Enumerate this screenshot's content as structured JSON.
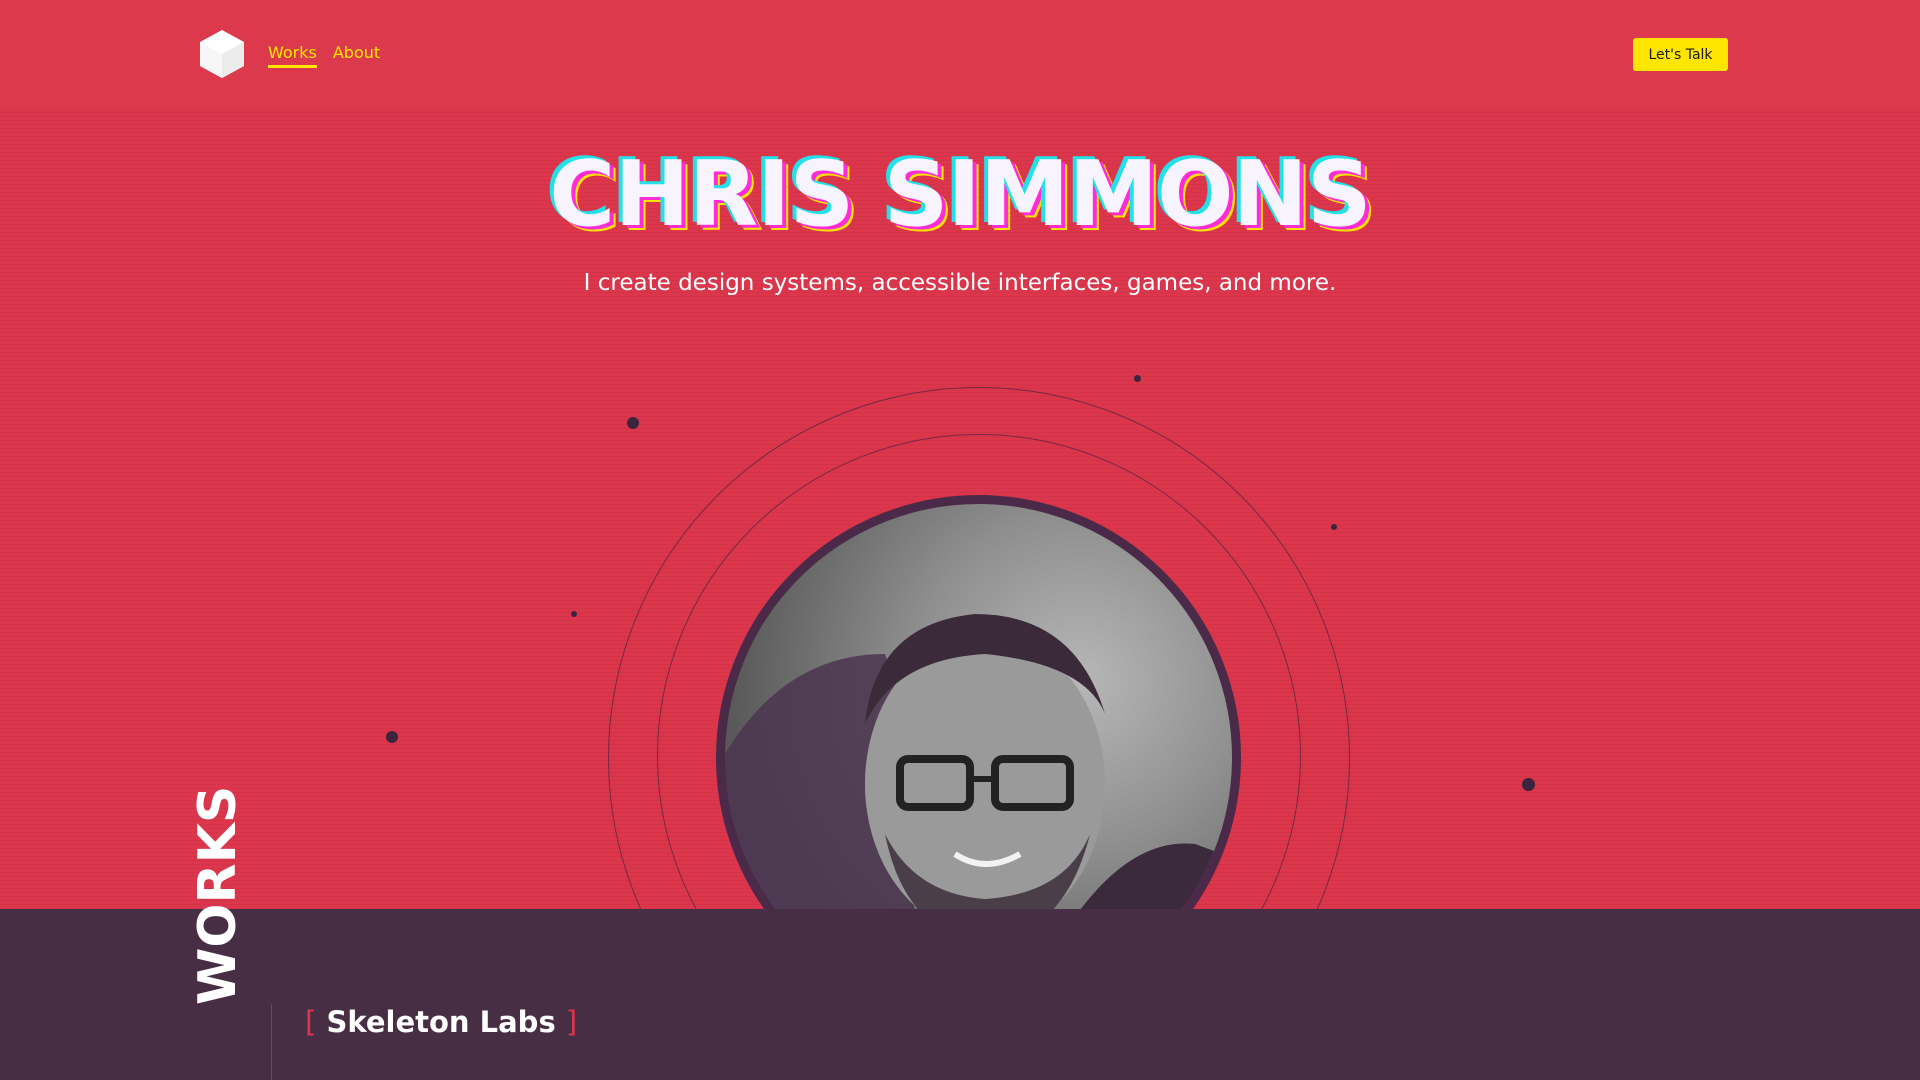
{
  "header": {
    "logo_icon": "hexagon-cube-icon",
    "nav": [
      {
        "label": "Works",
        "active": true
      },
      {
        "label": "About",
        "active": false
      }
    ],
    "cta_label": "Let's Talk"
  },
  "hero": {
    "title": "CHRIS SIMMONS",
    "subtitle": "I create design systems, accessible interfaces, games, and more.",
    "portrait_icon": "profile-photo"
  },
  "works": {
    "section_label": "WORKS",
    "project_title": "Skeleton Labs",
    "bracket_open": "[",
    "bracket_close": "]"
  },
  "colors": {
    "background": "#db364c",
    "accent": "#ffe600",
    "dark": "#472e45"
  }
}
